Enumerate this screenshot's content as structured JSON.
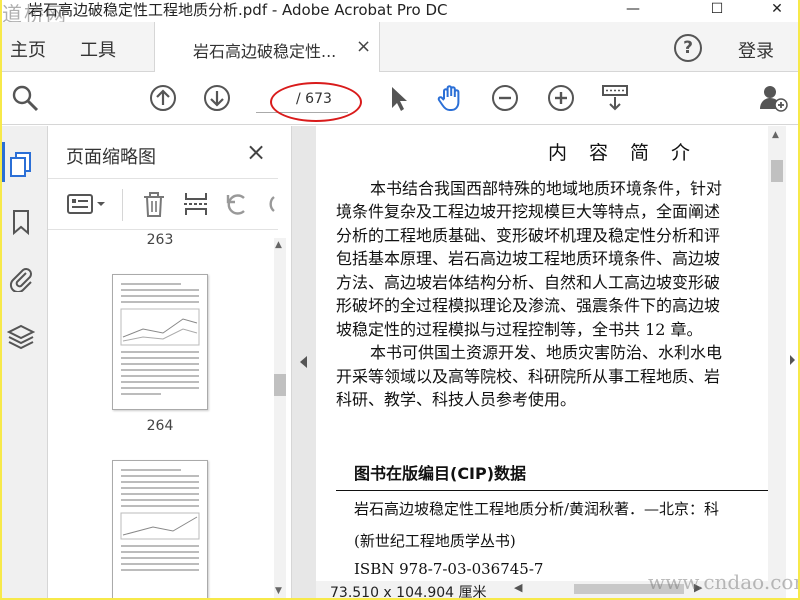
{
  "window": {
    "title": "岩石高边破稳定性工程地质分析.pdf - Adobe Acrobat Pro DC",
    "minimize": "—",
    "maximize": "☐",
    "close": "✕"
  },
  "watermarks": {
    "top_left": "道桥网",
    "bottom_right": "www.cndao.com"
  },
  "tabs": {
    "home": "主页",
    "tools": "工具",
    "document": "岩石高边破稳定性...",
    "document_close": "×",
    "help": "?",
    "login": "登录"
  },
  "toolbar": {
    "icons": [
      "search-icon",
      "page-up-icon",
      "page-down-icon",
      "select-arrow-icon",
      "hand-tool-icon",
      "zoom-out-icon",
      "zoom-in-icon",
      "read-mode-icon",
      "share-user-icon"
    ],
    "current_page": "",
    "total_pages": "/ 673",
    "active_color": "#2b6fd6",
    "annotation_color": "#d91b1b"
  },
  "rail": {
    "icons": [
      "page-thumbnails-icon",
      "bookmark-icon",
      "attachment-icon",
      "layers-icon"
    ]
  },
  "thumbnails": {
    "title": "页面缩略图",
    "close": "×",
    "pages": [
      {
        "label": "263"
      },
      {
        "label": "264"
      }
    ]
  },
  "document": {
    "heading": "内容简介",
    "paragraphs": [
      "本书结合我国西部特殊的地域地质环境条件，针对",
      "境条件复杂及工程边坡开挖规模巨大等特点，全面阐述",
      "分析的工程地质基础、变形破坏机理及稳定性分析和评",
      "包括基本原理、岩石高边坡工程地质环境条件、高边坡",
      "方法、高边坡岩体结构分析、自然和人工高边坡变形破",
      "形破坏的全过程模拟理论及渗流、强震条件下的高边坡",
      "坡稳定性的过程模拟与过程控制等，全书共 12 章。",
      "本书可供国土资源开发、地质灾害防治、水利水电",
      "开采等领域以及高等院校、科研院所从事工程地质、岩",
      "科研、教学、科技人员参考使用。"
    ],
    "cip_title": "图书在版编目(CIP)数据",
    "cip_lines": [
      "岩石高边坡稳定性工程地质分析/黄润秋著．—北京：科",
      "(新世纪工程地质学丛书)",
      "ISBN 978-7-03-036745-7"
    ]
  },
  "status": {
    "page_size": "73.510 x 104.904 厘米"
  }
}
